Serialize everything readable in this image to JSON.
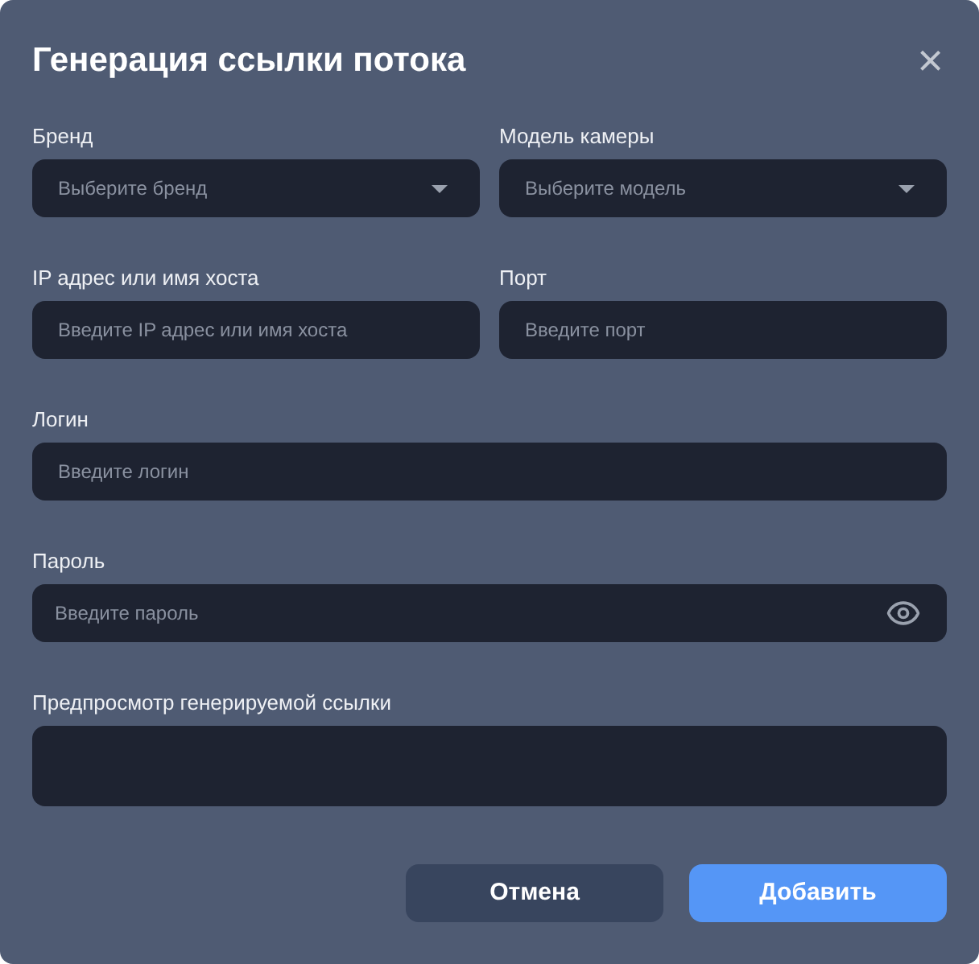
{
  "dialog": {
    "title": "Генерация ссылки потока",
    "close_symbol": "×"
  },
  "rows": [
    [
      {
        "kind": "select",
        "label": "Бренд",
        "placeholder": "Выберите бренд"
      },
      {
        "kind": "select",
        "label": "Модель камеры",
        "placeholder": "Выберите модель"
      }
    ],
    [
      {
        "kind": "text",
        "label": "IP адрес или имя хоста",
        "placeholder": "Введите IP адрес или имя хоста"
      },
      {
        "kind": "text",
        "label": "Порт",
        "placeholder": "Введите порт"
      }
    ],
    [
      {
        "kind": "text",
        "label": "Логин",
        "placeholder": "Введите логин"
      }
    ],
    [
      {
        "kind": "password",
        "label": "Пароль",
        "placeholder": "Введите пароль"
      }
    ],
    [
      {
        "kind": "preview",
        "label": "Предпросмотр генерируемой ссылки"
      }
    ]
  ],
  "buttons": [
    {
      "kind": "secondary",
      "label": "Отмена"
    },
    {
      "kind": "primary",
      "label": "Добавить"
    }
  ]
}
